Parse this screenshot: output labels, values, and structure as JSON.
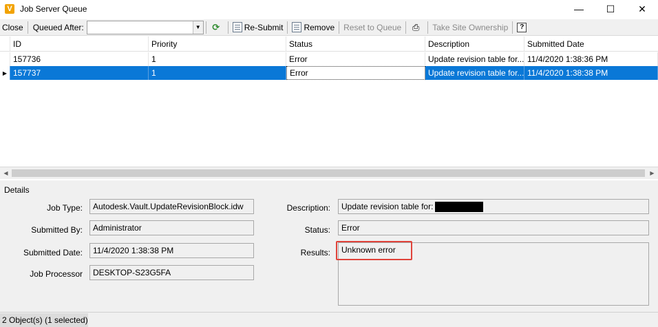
{
  "window": {
    "icon_letter": "V",
    "title": "Job Server Queue",
    "minimize": "—",
    "maximize": "☐",
    "close": "✕"
  },
  "toolbar": {
    "close_label": "Close",
    "queued_after_label": "Queued After:",
    "queued_after_value": "",
    "resubmit_label": "Re-Submit",
    "remove_label": "Remove",
    "reset_label": "Reset to Queue",
    "take_ownership_label": "Take Site Ownership",
    "help_label": "?"
  },
  "grid": {
    "columns": [
      "ID",
      "Priority",
      "Status",
      "Description",
      "Submitted Date"
    ],
    "rows": [
      {
        "id": "157736",
        "priority": "1",
        "status": "Error",
        "description": "Update revision table for...",
        "date": "11/4/2020 1:38:36 PM",
        "selected": false
      },
      {
        "id": "157737",
        "priority": "1",
        "status": "Error",
        "description": "Update revision table for...",
        "date": "11/4/2020 1:38:38 PM",
        "selected": true
      }
    ]
  },
  "details": {
    "title": "Details",
    "job_type_label": "Job Type:",
    "job_type_value": "Autodesk.Vault.UpdateRevisionBlock.idw",
    "submitted_by_label": "Submitted By:",
    "submitted_by_value": "Administrator",
    "submitted_date_label": "Submitted Date:",
    "submitted_date_value": "11/4/2020 1:38:38 PM",
    "job_processor_label": "Job Processor",
    "job_processor_value": "DESKTOP-S23G5FA",
    "description_label": "Description:",
    "description_value": "Update revision table for:",
    "status_label": "Status:",
    "status_value": "Error",
    "results_label": "Results:",
    "results_value": "Unknown error"
  },
  "statusbar": {
    "text": "2 Object(s) (1 selected)"
  },
  "colors": {
    "selection": "#0a78d7",
    "highlight_border": "#e0433a",
    "app_icon": "#f2a300"
  }
}
